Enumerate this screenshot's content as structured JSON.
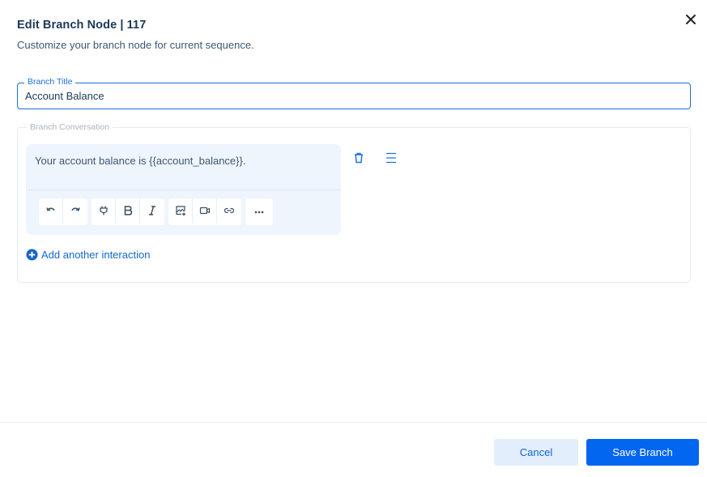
{
  "header": {
    "title": "Edit Branch Node | 117",
    "subtitle": "Customize your branch node for current sequence."
  },
  "branch_title": {
    "label": "Branch Title",
    "value": "Account Balance"
  },
  "branch_conversation": {
    "label": "Branch Conversation",
    "interactions": [
      {
        "text": "Your account balance is {{account_balance}}."
      }
    ],
    "toolbar": {
      "groups": [
        [
          "undo-icon",
          "redo-icon"
        ],
        [
          "plug-icon",
          "bold-icon",
          "italic-icon"
        ],
        [
          "image-icon",
          "video-icon",
          "link-icon"
        ],
        [
          "more-icon"
        ]
      ]
    },
    "add_label": "Add another interaction"
  },
  "footer": {
    "cancel_label": "Cancel",
    "save_label": "Save Branch"
  },
  "colors": {
    "accent": "#0366f0",
    "accent_text": "#1565c9",
    "cancel_bg": "#e2eefc",
    "interaction_bg": "#eef5fd"
  }
}
